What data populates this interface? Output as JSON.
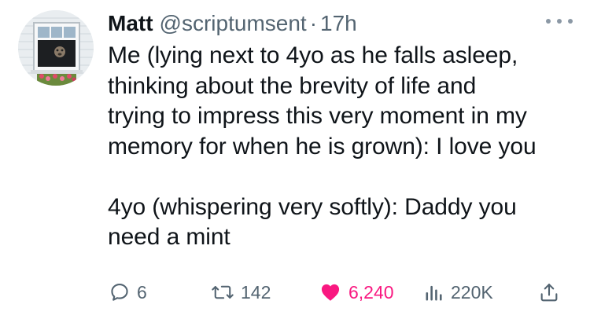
{
  "author": {
    "name": "Matt",
    "handle": "@scriptumsent",
    "separator": "·",
    "time": "17h"
  },
  "tweet": {
    "lines": [
      "Me (lying next to 4yo as he falls asleep,",
      "thinking about the brevity of life and",
      "trying to impress this very moment in my",
      "memory for when he is grown): I love you",
      "",
      "4yo (whispering very softly): Daddy you",
      "need a mint"
    ]
  },
  "actions": {
    "replies": "6",
    "reposts": "142",
    "likes": "6,240",
    "views": "220K"
  },
  "icons": {
    "more": "more-dots-icon",
    "reply": "reply-bubble-icon",
    "repost": "repost-arrows-icon",
    "like": "heart-icon",
    "views": "views-chart-icon",
    "share": "share-upload-icon"
  },
  "colors": {
    "text": "#0f1419",
    "secondary": "#536471",
    "like": "#f91880"
  }
}
